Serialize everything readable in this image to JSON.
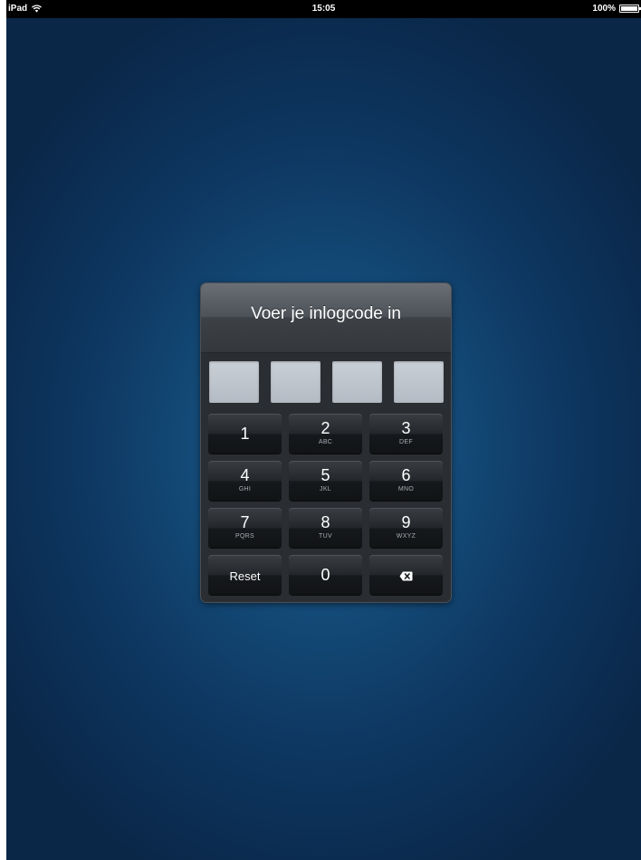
{
  "statusbar": {
    "device": "iPad",
    "time": "15:05",
    "battery": "100%"
  },
  "dialog": {
    "title": "Voer je inlogcode in",
    "code_boxes": [
      "",
      "",
      "",
      ""
    ]
  },
  "keypad": {
    "keys": [
      {
        "digit": "1",
        "letters": ""
      },
      {
        "digit": "2",
        "letters": "ABC"
      },
      {
        "digit": "3",
        "letters": "DEF"
      },
      {
        "digit": "4",
        "letters": "GHI"
      },
      {
        "digit": "5",
        "letters": "JKL"
      },
      {
        "digit": "6",
        "letters": "MNO"
      },
      {
        "digit": "7",
        "letters": "PQRS"
      },
      {
        "digit": "8",
        "letters": "TUV"
      },
      {
        "digit": "9",
        "letters": "WXYZ"
      }
    ],
    "reset_label": "Reset",
    "zero_label": "0",
    "backspace_icon": "backspace-icon"
  }
}
